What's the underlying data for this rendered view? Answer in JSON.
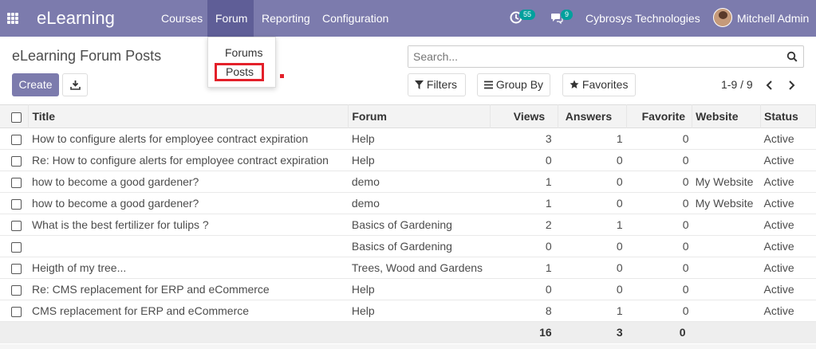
{
  "navbar": {
    "brand": "eLearning",
    "menu": [
      "Courses",
      "Forum",
      "Reporting",
      "Configuration"
    ],
    "active_menu": "Forum",
    "activity_count": "55",
    "message_count": "9",
    "company": "Cybrosys Technologies",
    "user": "Mitchell Admin",
    "color": "#7c7bad"
  },
  "dropdown": {
    "items": [
      "Forums",
      "Posts"
    ],
    "highlighted": "Posts",
    "highlight_color": "#e3202a"
  },
  "control": {
    "breadcrumb": "eLearning Forum Posts",
    "create_label": "Create",
    "search_placeholder": "Search...",
    "filters_label": "Filters",
    "groupby_label": "Group By",
    "favorites_label": "Favorites",
    "pager": "1-9 / 9"
  },
  "table": {
    "columns": [
      "Title",
      "Forum",
      "Views",
      "Answers",
      "Favorite",
      "Website",
      "Status"
    ],
    "rows": [
      {
        "title": "How to configure alerts for employee contract expiration",
        "forum": "Help",
        "views": "3",
        "answers": "1",
        "favorite": "0",
        "website": "",
        "status": "Active"
      },
      {
        "title": "Re: How to configure alerts for employee contract expiration",
        "forum": "Help",
        "views": "0",
        "answers": "0",
        "favorite": "0",
        "website": "",
        "status": "Active"
      },
      {
        "title": "how to become a good gardener?",
        "forum": "demo",
        "views": "1",
        "answers": "0",
        "favorite": "0",
        "website": "My Website",
        "status": "Active"
      },
      {
        "title": "how to become a good gardener?",
        "forum": "demo",
        "views": "1",
        "answers": "0",
        "favorite": "0",
        "website": "My Website",
        "status": "Active"
      },
      {
        "title": "What is the best fertilizer for tulips ?",
        "forum": "Basics of Gardening",
        "views": "2",
        "answers": "1",
        "favorite": "0",
        "website": "",
        "status": "Active"
      },
      {
        "title": "",
        "forum": "Basics of Gardening",
        "views": "0",
        "answers": "0",
        "favorite": "0",
        "website": "",
        "status": "Active"
      },
      {
        "title": "Heigth of my tree...",
        "forum": "Trees, Wood and Gardens",
        "views": "1",
        "answers": "0",
        "favorite": "0",
        "website": "",
        "status": "Active"
      },
      {
        "title": "Re: CMS replacement for ERP and eCommerce",
        "forum": "Help",
        "views": "0",
        "answers": "0",
        "favorite": "0",
        "website": "",
        "status": "Active"
      },
      {
        "title": "CMS replacement for ERP and eCommerce",
        "forum": "Help",
        "views": "8",
        "answers": "1",
        "favorite": "0",
        "website": "",
        "status": "Active"
      }
    ],
    "totals": {
      "views": "16",
      "answers": "3",
      "favorite": "0"
    }
  }
}
